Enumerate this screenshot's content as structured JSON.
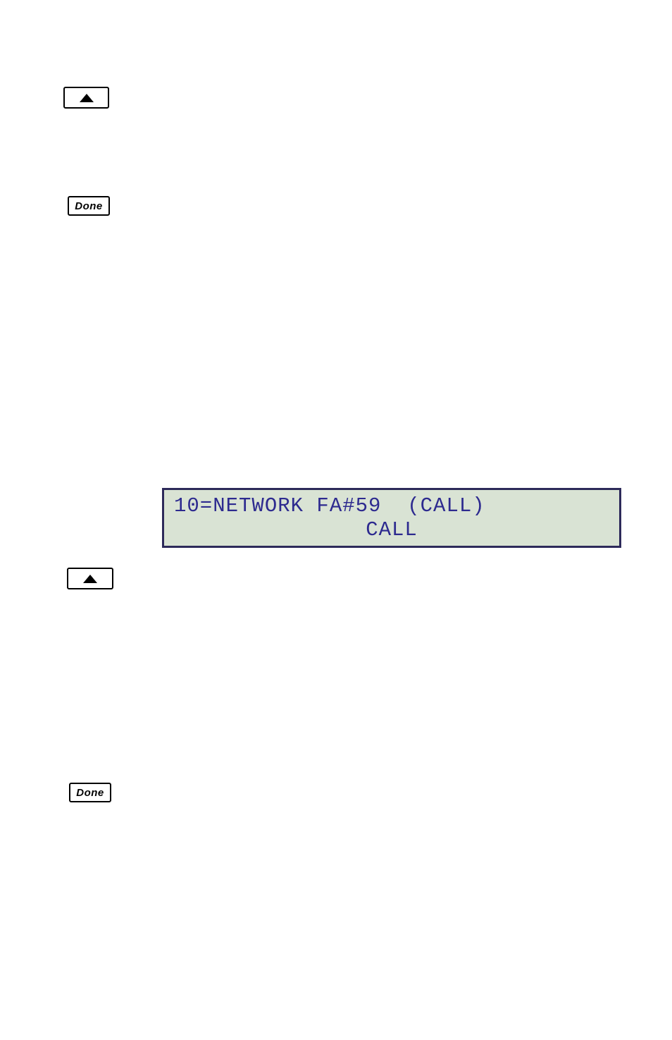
{
  "buttons": {
    "arrow1_name": "arrow-up-icon",
    "done1_label": "Done",
    "arrow2_name": "arrow-up-icon",
    "done2_label": "Done"
  },
  "lcd": {
    "line1": "10=NETWORK FA#59  (CALL)",
    "line2": "CALL"
  }
}
